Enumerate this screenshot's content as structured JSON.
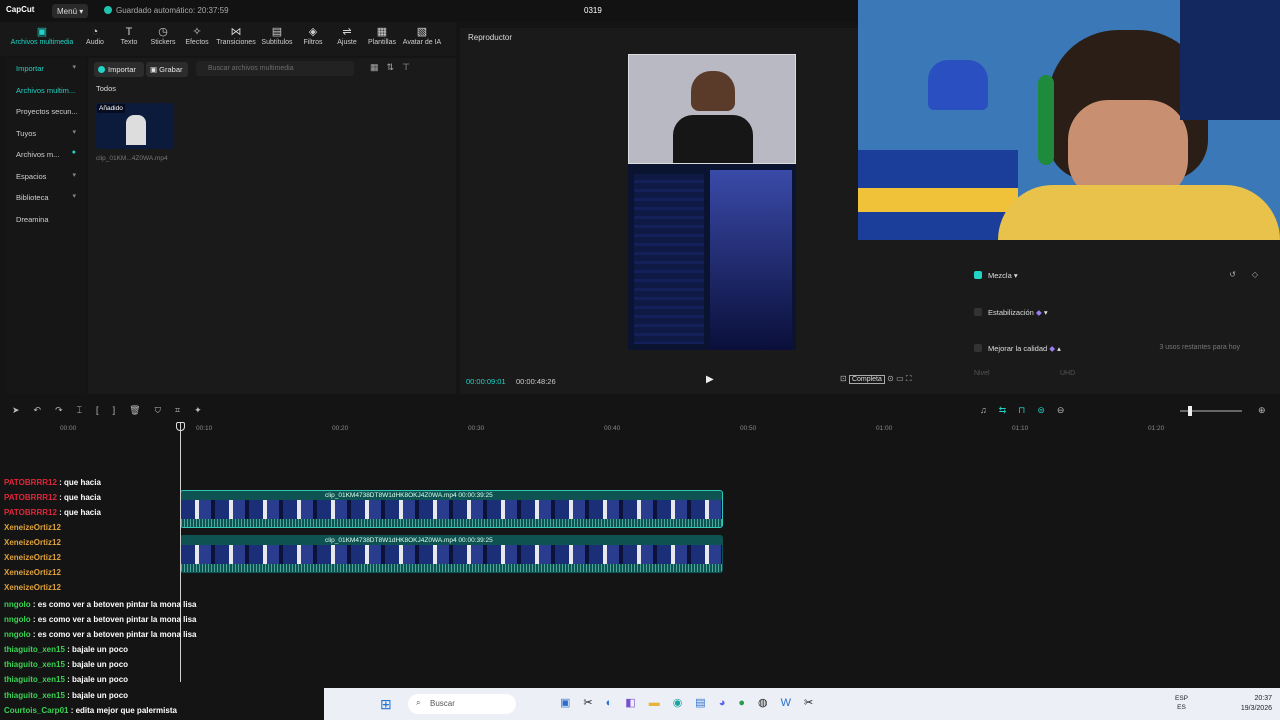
{
  "app": {
    "logo": "CapCut",
    "menu_label": "Menú",
    "saved_status": "Guardado automático: 20:37:59",
    "project_name": "0319"
  },
  "toolbar": {
    "tools": [
      {
        "label": "Archivos multimedia",
        "icon": "media-icon"
      },
      {
        "label": "Audio",
        "icon": "audio-icon"
      },
      {
        "label": "Texto",
        "icon": "text-icon"
      },
      {
        "label": "Stickers",
        "icon": "sticker-icon"
      },
      {
        "label": "Efectos",
        "icon": "effects-icon"
      },
      {
        "label": "Transiciones",
        "icon": "transition-icon"
      },
      {
        "label": "Subtítulos",
        "icon": "subtitle-icon"
      },
      {
        "label": "Filtros",
        "icon": "filter-icon"
      },
      {
        "label": "Ajuste",
        "icon": "adjust-icon"
      },
      {
        "label": "Plantillas",
        "icon": "template-icon"
      },
      {
        "label": "Avatar de IA",
        "icon": "avatar-icon"
      }
    ]
  },
  "sidebar": {
    "items": [
      {
        "label": "Importar"
      },
      {
        "label": "Archivos multim..."
      },
      {
        "label": "Proyectos secun..."
      },
      {
        "label": "Tuyos"
      },
      {
        "label": "Archivos m..."
      },
      {
        "label": "Espacios"
      },
      {
        "label": "Biblioteca"
      },
      {
        "label": "Dreamina"
      }
    ]
  },
  "media": {
    "import_label": "Importar",
    "record_label": "Grabar",
    "search_placeholder": "Buscar archivos multimedia",
    "filter_label": "Todos",
    "thumb_badge": "Añadido",
    "thumb_name": "clip_01KM...4Z0WA.mp4"
  },
  "player": {
    "title": "Reproductor",
    "current_time": "00:00:09:01",
    "total_time": "00:00:48:26",
    "complete_label": "Completa"
  },
  "properties": {
    "mix_label": "Mezcla",
    "stab_label": "Estabilización",
    "quality_label": "Mejorar la calidad",
    "remaining_uses": "3 usos restantes para hoy",
    "level_label": "Nivel",
    "uhd_label": "UHD"
  },
  "timeline": {
    "ruler": [
      "00:00",
      "00:10",
      "00:20",
      "00:30",
      "00:40",
      "00:50",
      "01:00",
      "01:10",
      "01:20"
    ],
    "track1_label": "clip_01KM4738DT8W1dHK8OKJ4Z0WA.mp4  00:00:39:25",
    "track2_label": "clip_01KM4738DT8W1dHK8OKJ4Z0WA.mp4  00:00:39:25"
  },
  "chat": [
    {
      "user": "PATOBRRR12",
      "msg": "que hacia",
      "color": "#e0263a"
    },
    {
      "user": "PATOBRRR12",
      "msg": "que hacia",
      "color": "#e0263a"
    },
    {
      "user": "PATOBRRR12",
      "msg": "que hacia",
      "color": "#e0263a"
    },
    {
      "user": "XeneizeOrtiz12",
      "msg": "",
      "color": "#e0a23c"
    },
    {
      "user": "XeneizeOrtiz12",
      "msg": "",
      "color": "#e0a23c"
    },
    {
      "user": "XeneizeOrtiz12",
      "msg": "",
      "color": "#e0a23c"
    },
    {
      "user": "XeneizeOrtiz12",
      "msg": "",
      "color": "#e0a23c"
    },
    {
      "user": "XeneizeOrtiz12",
      "msg": "",
      "color": "#e0a23c"
    },
    {
      "user": "nngolo",
      "msg": "es como ver a betoven pintar la mona lisa",
      "color": "#39d353"
    },
    {
      "user": "nngolo",
      "msg": "es como ver a betoven pintar la mona lisa",
      "color": "#39d353"
    },
    {
      "user": "nngolo",
      "msg": "es como ver a betoven pintar la mona lisa",
      "color": "#39d353"
    },
    {
      "user": "thiaguito_xen15",
      "msg": "bajale un poco",
      "color": "#39d353"
    },
    {
      "user": "thiaguito_xen15",
      "msg": "bajale un poco",
      "color": "#39d353"
    },
    {
      "user": "thiaguito_xen15",
      "msg": "bajale un poco",
      "color": "#39d353"
    },
    {
      "user": "thiaguito_xen15",
      "msg": "bajale un poco",
      "color": "#39d353"
    },
    {
      "user": "Courtois_Carp01",
      "msg": "edita mejor que palermista",
      "color": "#39d353"
    }
  ],
  "taskbar": {
    "search_label": "Buscar",
    "lang": "ESP",
    "lang_sub": "ES",
    "time": "20:37",
    "date": "19/3/2026"
  },
  "colors": {
    "accent": "#21d4c6",
    "panel": "#1a1a1a",
    "bg": "#141414"
  }
}
